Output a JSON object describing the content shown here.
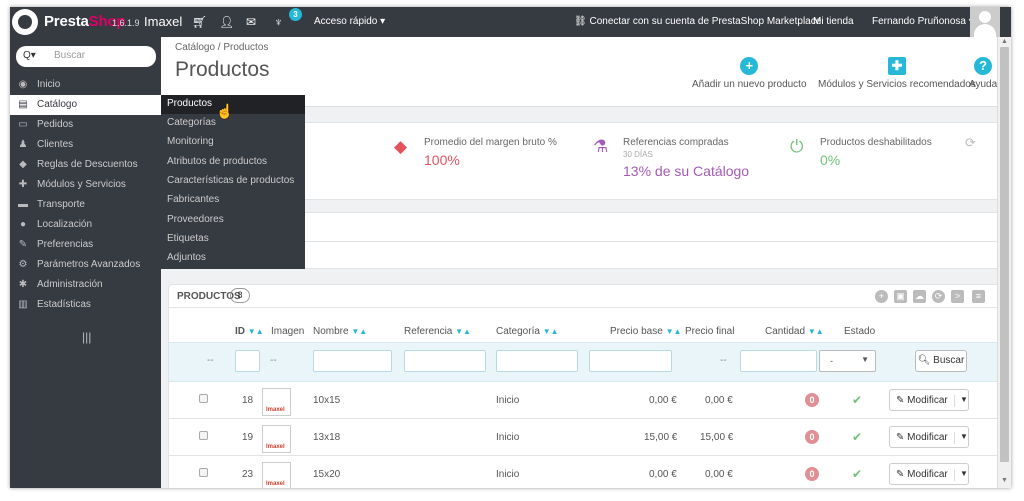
{
  "topbar": {
    "brand_part1": "Presta",
    "brand_part2": "Shop",
    "version": "1.6.1.9",
    "shop_name": "Imaxel",
    "notif_count": "3",
    "quick_access": "Acceso rápido ▾",
    "marketplace": "Conectar con su cuenta de PrestaShop Marketplace",
    "my_shop": "Mi tienda",
    "user": "Fernando Pruñonosa ▾"
  },
  "sidebar": {
    "search_icon": "Q▾",
    "search_placeholder": "Buscar",
    "items": [
      {
        "label": "Inicio",
        "icon": "◉"
      },
      {
        "label": "Catálogo",
        "icon": "▤"
      },
      {
        "label": "Pedidos",
        "icon": "▭"
      },
      {
        "label": "Clientes",
        "icon": "♟"
      },
      {
        "label": "Reglas de Descuentos",
        "icon": "◆"
      },
      {
        "label": "Módulos y Servicios",
        "icon": "✚"
      },
      {
        "label": "Transporte",
        "icon": "▬"
      },
      {
        "label": "Localización",
        "icon": "●"
      },
      {
        "label": "Preferencias",
        "icon": "✎"
      },
      {
        "label": "Parámetros Avanzados",
        "icon": "⚙"
      },
      {
        "label": "Administración",
        "icon": "✱"
      },
      {
        "label": "Estadísticas",
        "icon": "▥"
      }
    ]
  },
  "submenu": [
    "Productos",
    "Categorías",
    "Monitoring",
    "Atributos de productos",
    "Características de productos",
    "Fabricantes",
    "Proveedores",
    "Etiquetas",
    "Adjuntos"
  ],
  "header": {
    "breadcrumb": "Catálogo  /  Productos",
    "title": "Productos",
    "btn_add": "Añadir un nuevo producto",
    "btn_modules": "Módulos y Servicios recomendados",
    "btn_help": "Ayuda"
  },
  "kpis": [
    {
      "title": "Promedio del margen bruto %",
      "sub": "",
      "value": "100%",
      "color": "#e5525d"
    },
    {
      "title": "Referencias compradas",
      "sub": "30 DÍAS",
      "value": "13% de su Catálogo",
      "color": "#a45ab6"
    },
    {
      "title": "Productos deshabilitados",
      "sub": "",
      "value": "0%",
      "color": "#72c279"
    }
  ],
  "products": {
    "heading": "PRODUCTOS",
    "count": "8",
    "columns": {
      "id": "ID",
      "image": "Imagen",
      "name": "Nombre",
      "reference": "Referencia",
      "category": "Categoría",
      "base_price": "Precio base",
      "final_price": "Precio final",
      "quantity": "Cantidad",
      "status": "Estado"
    },
    "filter_dash": "--",
    "status_select": "-",
    "search_button": "Buscar",
    "rows": [
      {
        "id": "18",
        "img_label": "Imaxel",
        "name": "10x15",
        "category": "Inicio",
        "base": "0,00 €",
        "final": "0,00 €",
        "qty": "0",
        "action": "Modificar"
      },
      {
        "id": "19",
        "img_label": "Imaxel",
        "name": "13x18",
        "category": "Inicio",
        "base": "15,00 €",
        "final": "15,00 €",
        "qty": "0",
        "action": "Modificar"
      },
      {
        "id": "23",
        "img_label": "Imaxel",
        "name": "15x20",
        "category": "Inicio",
        "base": "0,00 €",
        "final": "0,00 €",
        "qty": "0",
        "action": "Modificar"
      }
    ]
  }
}
